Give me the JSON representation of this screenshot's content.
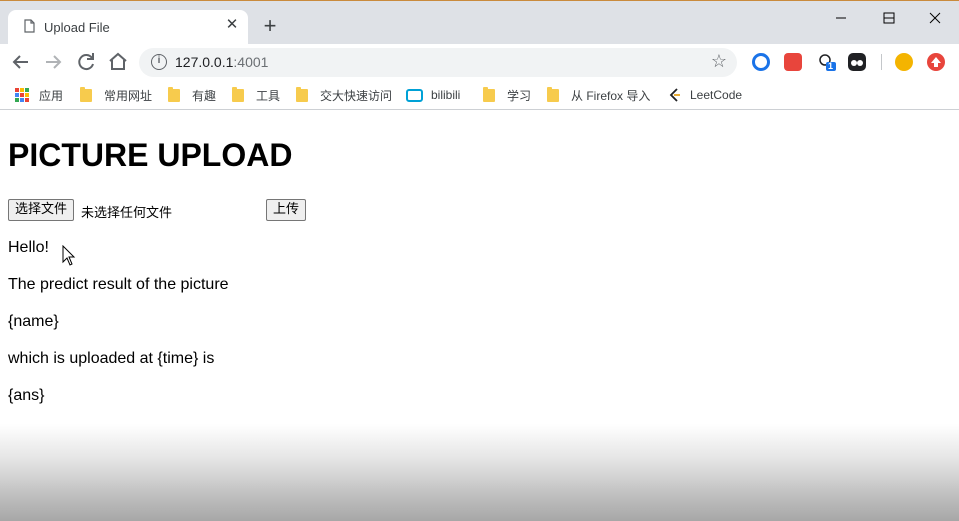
{
  "browser": {
    "tab": {
      "title": "Upload File",
      "close_glyph": "✕"
    },
    "new_tab_glyph": "+",
    "window_controls": {
      "minimize": "—",
      "maximize": "☐",
      "close": "✕"
    },
    "nav": {
      "back": "←",
      "forward": "→",
      "reload": "↻",
      "home": "⌂"
    },
    "address": {
      "host": "127.0.0.1",
      "port": ":4001",
      "info_glyph": "i",
      "star_glyph": "☆"
    },
    "extensions": [
      {
        "name": "ext-compass-icon",
        "label": "",
        "color": "#1a73e8"
      },
      {
        "name": "ext-red-icon",
        "label": "",
        "color": "#e8453c"
      },
      {
        "name": "ext-badge-icon",
        "label": "1",
        "color": "#1a73e8"
      },
      {
        "name": "ext-tampermonkey-icon",
        "label": "",
        "color": "#202124"
      },
      {
        "name": "ext-emoji-icon",
        "label": "",
        "color": "#f4b400"
      },
      {
        "name": "ext-up-icon",
        "label": "",
        "color": "#e8453c"
      }
    ],
    "bookmarks": [
      {
        "label": "应用",
        "type": "apps"
      },
      {
        "label": "常用网址",
        "type": "folder"
      },
      {
        "label": "有趣",
        "type": "folder"
      },
      {
        "label": "工具",
        "type": "folder"
      },
      {
        "label": "交大快速访问",
        "type": "folder"
      },
      {
        "label": "bilibili",
        "type": "bilibili"
      },
      {
        "label": "学习",
        "type": "folder"
      },
      {
        "label": "从 Firefox 导入",
        "type": "folder"
      },
      {
        "label": "LeetCode",
        "type": "leetcode"
      }
    ]
  },
  "page": {
    "title": "PICTURE UPLOAD",
    "file_button": "选择文件",
    "file_status": "未选择任何文件",
    "upload_button": "上传",
    "lines": [
      "Hello!",
      "The predict result of the picture",
      "{name}",
      "which is uploaded at {time} is",
      "{ans}"
    ]
  }
}
